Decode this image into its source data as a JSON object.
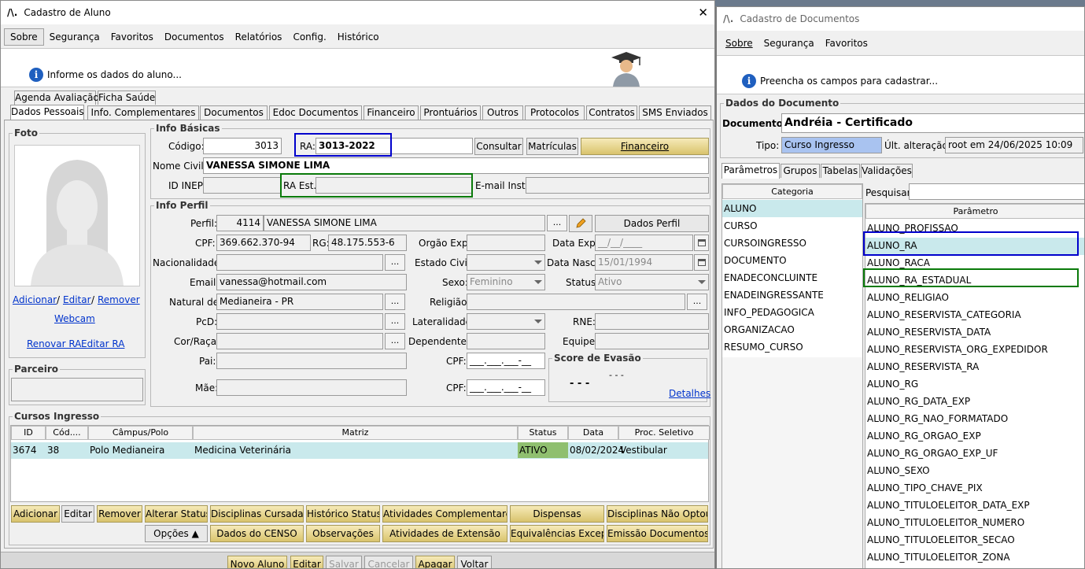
{
  "left_window": {
    "logo": "/\\.",
    "title": "Cadastro de Aluno",
    "close": "✕",
    "menu": [
      "Sobre",
      "Segurança",
      "Favoritos",
      "Documentos",
      "Relatórios",
      "Config.",
      "Histórico"
    ],
    "banner_text": "Informe os dados do aluno...",
    "top_tabs": [
      "Agenda Avaliação",
      "Ficha Saúde"
    ],
    "tabs": [
      "Dados Pessoais",
      "Info. Complementares",
      "Documentos",
      "Edoc Documentos",
      "Financeiro",
      "Prontuários",
      "Outros",
      "Protocolos",
      "Contratos",
      "SMS Enviados"
    ],
    "foto": {
      "label": "Foto",
      "adicionar": "Adicionar",
      "sep1": "/",
      "editar": "Editar",
      "sep2": "/",
      "remover": "Remover",
      "webcam": "Webcam",
      "renovar_ra": "Renovar RA",
      "editar_ra": "Editar RA"
    },
    "parceiro_label": "Parceiro",
    "info_basicas": {
      "label": "Info Básicas",
      "codigo_label": "Código:",
      "codigo": "3013",
      "ra_label": "RA:",
      "ra": "3013-2022",
      "consultar": "Consultar",
      "matriculas": "Matrículas",
      "financeiro": "Financeiro",
      "nome_label": "Nome Civil:",
      "nome": "VANESSA SIMONE LIMA",
      "inep_label": "ID INEP:",
      "ra_est_label": "RA Est.:",
      "email_inst_label": "E-mail Inst.:"
    },
    "info_perfil": {
      "label": "Info Perfil",
      "perfil_label": "Perfil:",
      "perfil_code": "4114",
      "perfil_name": "VANESSA SIMONE LIMA",
      "dots": "...",
      "dados_perfil": "Dados Perfil",
      "cpf_label": "CPF:",
      "cpf": "369.662.370-94",
      "rg_label": "RG:",
      "rg": "48.175.553-6",
      "orgao_label": "Orgão Exp:",
      "data_exp_label": "Data Exp.:",
      "data_exp": "__/__/____",
      "nacionalidade_label": "Nacionalidade:",
      "estado_civil_label": "Estado Civil:",
      "data_nasc_label": "Data Nasc.:",
      "data_nasc": "15/01/1994",
      "email_label": "Email:",
      "email": "vanessa@hotmail.com",
      "sexo_label": "Sexo:",
      "sexo": "Feminino",
      "status_label": "Status:",
      "status": "Ativo",
      "natural_label": "Natural de:",
      "natural": "Medianeira - PR",
      "religiao_label": "Religião:",
      "pcd_label": "PcD:",
      "lateralidade_label": "Lateralidade:",
      "rne_label": "RNE:",
      "cor_label": "Cor/Raça:",
      "dependentes_label": "Dependentes:",
      "equipe_label": "Equipe:",
      "pai_label": "Pai:",
      "cpf_pai_label": "CPF:",
      "cpf_mask": "___.___.___-__",
      "mae_label": "Mãe:",
      "cpf_mae_label": "CPF:",
      "score_label": "Score de Evasão",
      "score_small": "- - -",
      "score_big": "- - -",
      "detalhes": "Detalhes"
    },
    "cursos": {
      "label": "Cursos Ingresso",
      "columns": [
        "ID",
        "Cód....",
        "Câmpus/Polo",
        "Matriz",
        "Status",
        "Data",
        "Proc. Seletivo"
      ],
      "rows": [
        {
          "id": "3674",
          "cod": "38",
          "campus": "Polo Medianeira",
          "matriz": "Medicina Veterinária",
          "status": "ATIVO",
          "data": "08/02/2024",
          "proc": "Vestibular"
        }
      ],
      "status_color": "#8fbf6f"
    },
    "buttons_row1": [
      "Adicionar",
      "Editar",
      "Remover",
      "Alterar Status",
      "Disciplinas Cursadas",
      "Histórico Status",
      "Atividades Complementares",
      "Dispensas",
      "Disciplinas Não Optou"
    ],
    "buttons_row2": [
      "Opções ▲",
      "Dados do CENSO",
      "Observações",
      "Atividades de Extensão",
      "Equivalências Excep.",
      "Emissão Documentos"
    ],
    "bottom_buttons": [
      "Novo Aluno",
      "Editar",
      "Salvar",
      "Cancelar",
      "Apagar",
      "Voltar"
    ]
  },
  "right_window": {
    "logo": "/\\.",
    "title": "Cadastro de Documentos",
    "menu": [
      "Sobre",
      "Segurança",
      "Favoritos"
    ],
    "banner_text": "Preencha os campos para cadastrar...",
    "dados_label": "Dados do Documento",
    "documento_label": "Documento:",
    "documento": "Andréia - Certificado",
    "tipo_label": "Tipo:",
    "tipo": "Curso Ingresso",
    "ult_label": "Últ. alteração:",
    "ult": "root em 24/06/2025 10:09",
    "tabs": [
      "Parâmetros",
      "Grupos",
      "Tabelas",
      "Validações"
    ],
    "categoria_header": "Categoria",
    "categorias": [
      "ALUNO",
      "CURSO",
      "CURSOINGRESSO",
      "DOCUMENTO",
      "ENADECONCLUINTE",
      "ENADEINGRESSANTE",
      "INFO_PEDAGOGICA",
      "ORGANIZACAO",
      "RESUMO_CURSO"
    ],
    "pesquisar_label": "Pesquisar:",
    "parametro_header": "Parâmetro",
    "parametros": [
      "ALUNO_PROFISSAO",
      "ALUNO_RA",
      "ALUNO_RACA",
      "ALUNO_RA_ESTADUAL",
      "ALUNO_RELIGIAO",
      "ALUNO_RESERVISTA_CATEGORIA",
      "ALUNO_RESERVISTA_DATA",
      "ALUNO_RESERVISTA_ORG_EXPEDIDOR",
      "ALUNO_RESERVISTA_RA",
      "ALUNO_RG",
      "ALUNO_RG_DATA_EXP",
      "ALUNO_RG_NAO_FORMATADO",
      "ALUNO_RG_ORGAO_EXP",
      "ALUNO_RG_ORGAO_EXP_UF",
      "ALUNO_SEXO",
      "ALUNO_TIPO_CHAVE_PIX",
      "ALUNO_TITULOELEITOR_DATA_EXP",
      "ALUNO_TITULOELEITOR_NUMERO",
      "ALUNO_TITULOELEITOR_SECAO",
      "ALUNO_TITULOELEITOR_ZONA"
    ],
    "selection_color": "#c9e9ec",
    "tipo_color": "#a9c3f0"
  },
  "colors": {
    "highlight_blue": "#0000cc",
    "highlight_green": "#0a7a0a",
    "link": "#0033cc"
  }
}
